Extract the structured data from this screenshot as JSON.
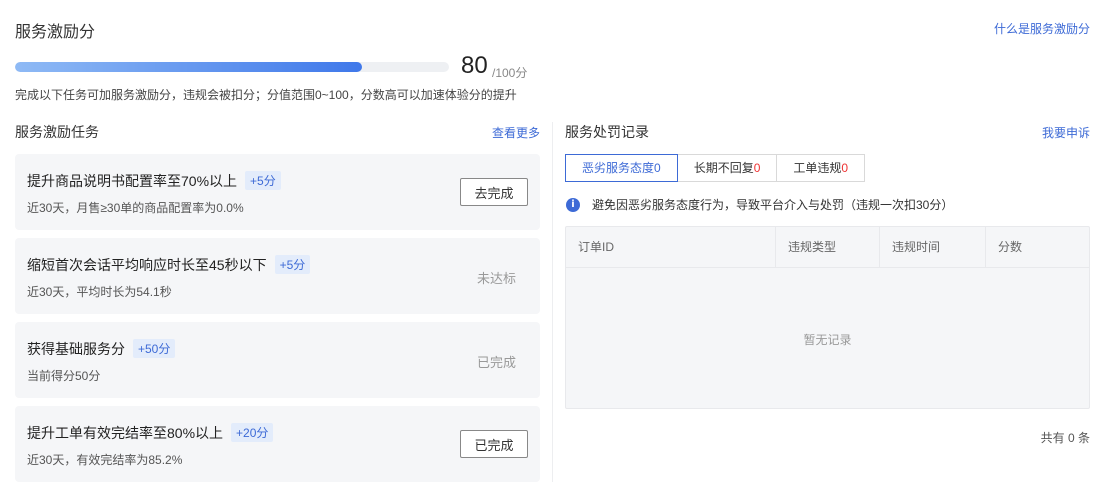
{
  "header": {
    "title": "服务激励分",
    "what_link": "什么是服务激励分"
  },
  "score": {
    "value": "80",
    "total": "/100分",
    "progress_fraction": 0.8
  },
  "description": "完成以下任务可加服务激励分，违规会被扣分；分值范围0~100，分数高可以加速体验分的提升",
  "tasks_section": {
    "title": "服务激励任务",
    "more_link": "查看更多",
    "items": [
      {
        "title": "提升商品说明书配置率至70%以上",
        "tag": "+5分",
        "sub": "近30天，月售≥30单的商品配置率为0.0%",
        "action": "去完成",
        "kind": "button"
      },
      {
        "title": "缩短首次会话平均响应时长至45秒以下",
        "tag": "+5分",
        "sub": "近30天，平均时长为54.1秒",
        "action": "未达标",
        "kind": "status"
      },
      {
        "title": "获得基础服务分",
        "tag": "+50分",
        "sub": "当前得分50分",
        "action": "已完成",
        "kind": "status"
      },
      {
        "title": "提升工单有效完结率至80%以上",
        "tag": "+20分",
        "sub": "近30天，有效完结率为85.2%",
        "action": "已完成",
        "kind": "button"
      }
    ]
  },
  "penalty_section": {
    "title": "服务处罚记录",
    "appeal_link": "我要申诉",
    "tabs": [
      {
        "label": "恶劣服务态度",
        "count": "0"
      },
      {
        "label": "长期不回复",
        "count": "0"
      },
      {
        "label": "工单违规",
        "count": "0"
      }
    ],
    "notice": "避免因恶劣服务态度行为，导致平台介入与处罚（违规一次扣30分）",
    "columns": [
      "订单ID",
      "违规类型",
      "违规时间",
      "分数"
    ],
    "empty_text": "暂无记录",
    "total_text": "共有 0 条"
  },
  "colors": {
    "accent": "#3d6ad6",
    "progress_start": "#8fbaf5",
    "progress_end": "#3f78ea",
    "alert": "#e33"
  }
}
